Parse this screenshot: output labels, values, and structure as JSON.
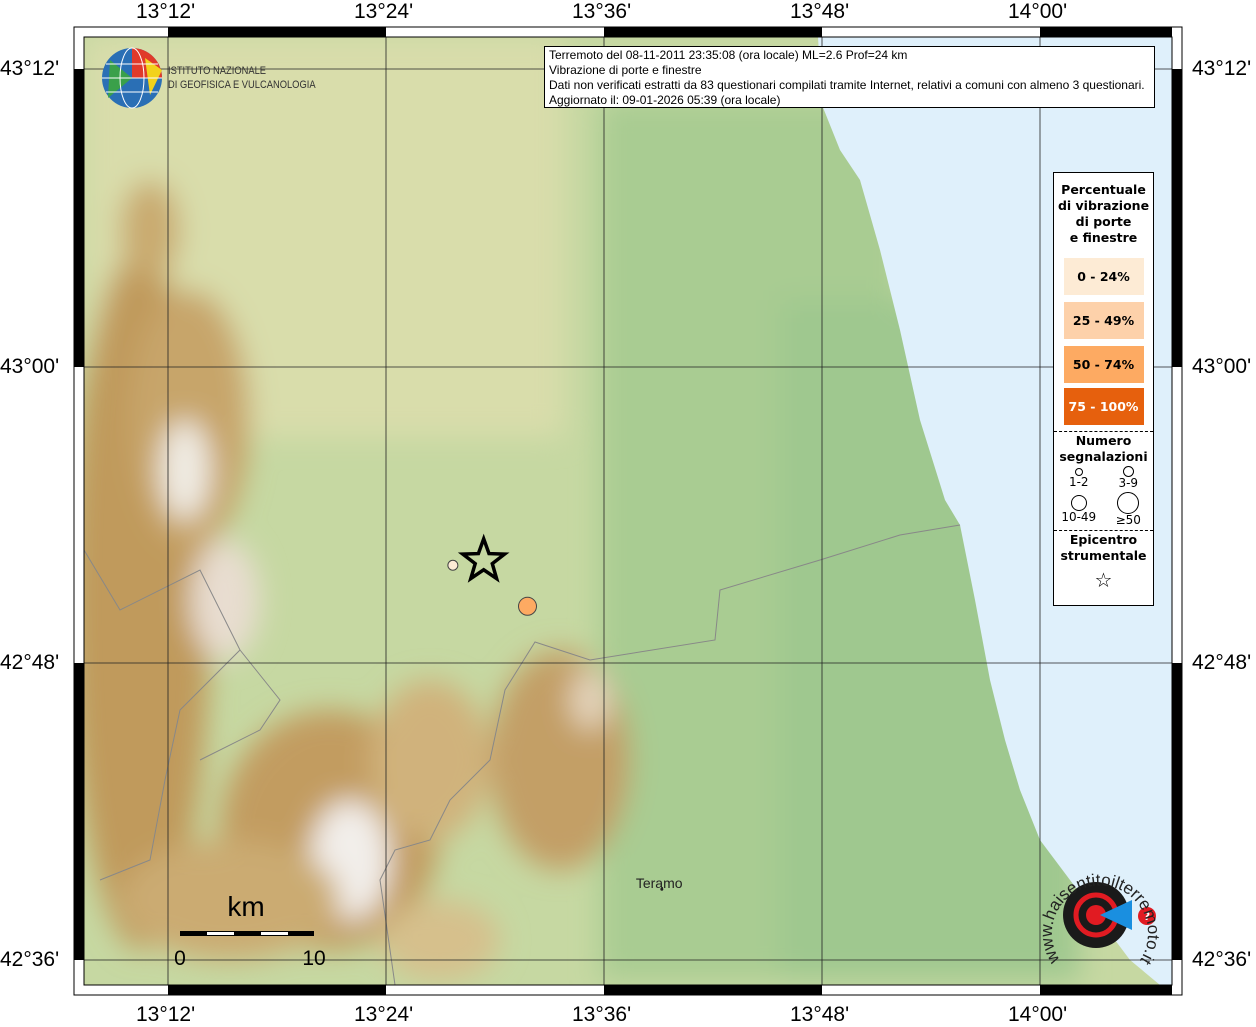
{
  "info": {
    "line1": "Terremoto del 08-11-2011 23:35:08 (ora locale) ML=2.6 Prof=24 km",
    "line2": "Vibrazione di porte e finestre",
    "line3": "Dati non verificati estratti da 83 questionari compilati tramite Internet, relativi a comuni con almeno 3 questionari.",
    "line4": "Aggiornato il: 09-01-2026 05:39 (ora locale)"
  },
  "institute": {
    "line1": "ISTITUTO NAZIONALE",
    "line2": "DI GEOFISICA E VULCANOLOGIA"
  },
  "axes": {
    "lon_labels": [
      "13°12'",
      "13°24'",
      "13°36'",
      "13°48'",
      "14°00'"
    ],
    "lat_labels": [
      "43°12'",
      "43°00'",
      "42°48'",
      "42°36'"
    ],
    "lon_range": [
      13.1233,
      14.2167
    ],
    "lat_range": [
      42.5967,
      43.2433
    ]
  },
  "legend": {
    "title": [
      "Percentuale",
      "di vibrazione",
      "di porte",
      "e finestre"
    ],
    "classes": [
      {
        "label": "0 - 24%",
        "color": "#fdebd5"
      },
      {
        "label": "25 - 49%",
        "color": "#fdd1aa"
      },
      {
        "label": "50 - 74%",
        "color": "#fdaa62"
      },
      {
        "label": "75 - 100%",
        "color": "#e6600d"
      }
    ],
    "count_title": [
      "Numero",
      "segnalazioni"
    ],
    "counts": [
      "1-2",
      "3-9",
      "10-49",
      "≥50"
    ],
    "epicenter_title": [
      "Epicentro",
      "strumentale"
    ]
  },
  "epicenter": {
    "lon": 13.525,
    "lat": 42.886
  },
  "reports": [
    {
      "lon": 13.494,
      "lat": 42.883,
      "class": 0,
      "count": "1-2"
    },
    {
      "lon": 13.569,
      "lat": 42.855,
      "class": 2,
      "count": "3-9"
    }
  ],
  "places": [
    {
      "name": "Teramo",
      "lon": 13.704,
      "lat": 42.662
    }
  ],
  "scale": {
    "unit": "km",
    "start": "0",
    "end": "10"
  },
  "logo": {
    "text": "www.haisentitoilterremoto.it"
  },
  "colors": {
    "sea": "#dff0fb",
    "land": "#b9cf98",
    "mountain": "#b8894a"
  }
}
